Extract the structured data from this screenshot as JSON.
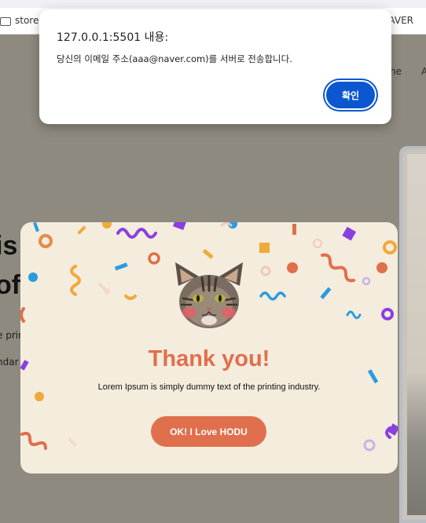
{
  "browser": {
    "bookmark_left": "store",
    "bookmark_right": "AVER"
  },
  "background_page": {
    "nav_home": "ne",
    "nav_a": "A",
    "hero_line1": "is",
    "hero_line2": "of",
    "body_line1": "e prin",
    "body_line2": "ndar"
  },
  "modal": {
    "image": "cat-face",
    "title": "Thank you!",
    "text": "Lorem Ipsum is simply dummy text of the printing industry.",
    "button_label": "OK! I Love HODU",
    "colors": {
      "background": "#f4ecdc",
      "accent": "#e06f4d"
    }
  },
  "alert": {
    "title": "127.0.0.1:5501 내용:",
    "message": "당신의 이메일 주소(aaa@naver.com)를 서버로 전송합니다.",
    "confirm_label": "확인",
    "colors": {
      "button": "#0b57d0"
    }
  }
}
